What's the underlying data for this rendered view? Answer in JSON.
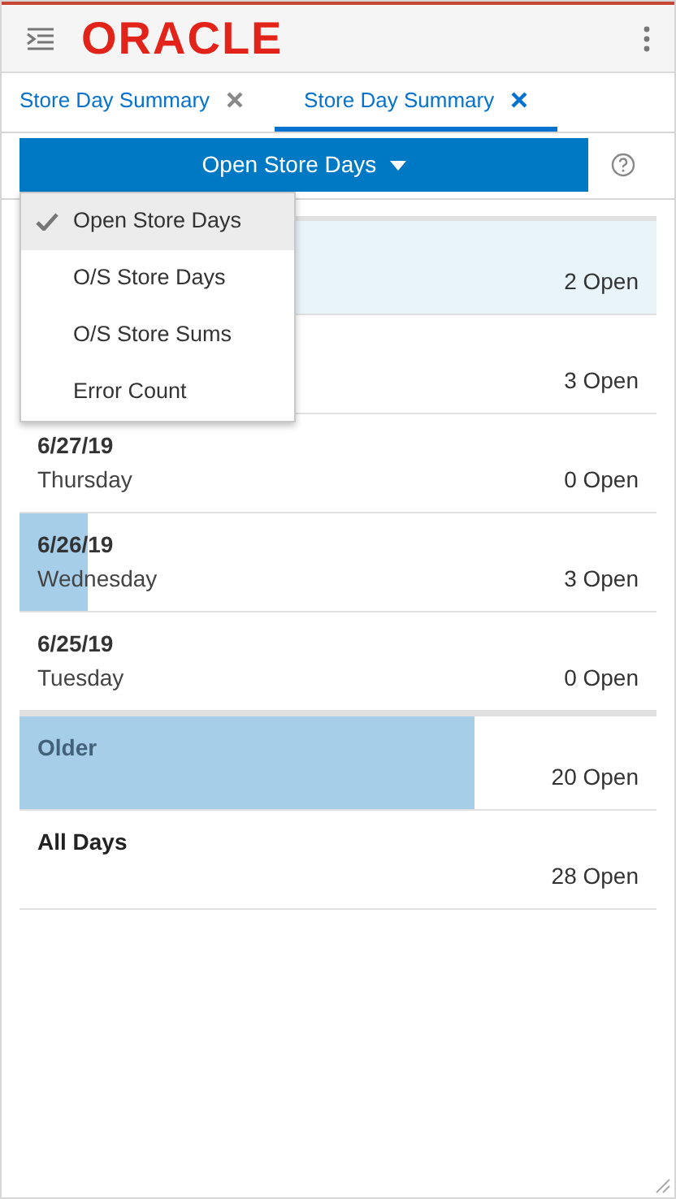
{
  "header": {
    "logo": "ORACLE"
  },
  "tabs": [
    {
      "label": "Store Day Summary",
      "selected": false
    },
    {
      "label": "Store Day Summary",
      "selected": true
    }
  ],
  "view_button": {
    "label": "Open Store Days"
  },
  "menu": [
    {
      "label": "Open Store Days",
      "selected": true
    },
    {
      "label": "O/S Store Days",
      "selected": false
    },
    {
      "label": "O/S Store Sums",
      "selected": false
    },
    {
      "label": "Error Count",
      "selected": false
    }
  ],
  "rows": [
    {
      "kind": "day",
      "count": "2 Open",
      "selected": true
    },
    {
      "kind": "day",
      "count": "3 Open",
      "selected": false
    },
    {
      "kind": "day",
      "date": "6/27/19",
      "weekday": "Thursday",
      "count": "0 Open",
      "selected": false
    },
    {
      "kind": "day",
      "date": "6/26/19",
      "weekday": "Wednesday",
      "count": "3 Open",
      "selected": false,
      "level": 0.107
    },
    {
      "kind": "day",
      "date": "6/25/19",
      "weekday": "Tuesday",
      "count": "0 Open",
      "selected": false
    },
    {
      "kind": "group",
      "date": "Older",
      "count": "20 Open",
      "selected": false,
      "level": 0.714
    },
    {
      "kind": "total",
      "date": "All Days",
      "count": "28 Open",
      "selected": false
    }
  ]
}
